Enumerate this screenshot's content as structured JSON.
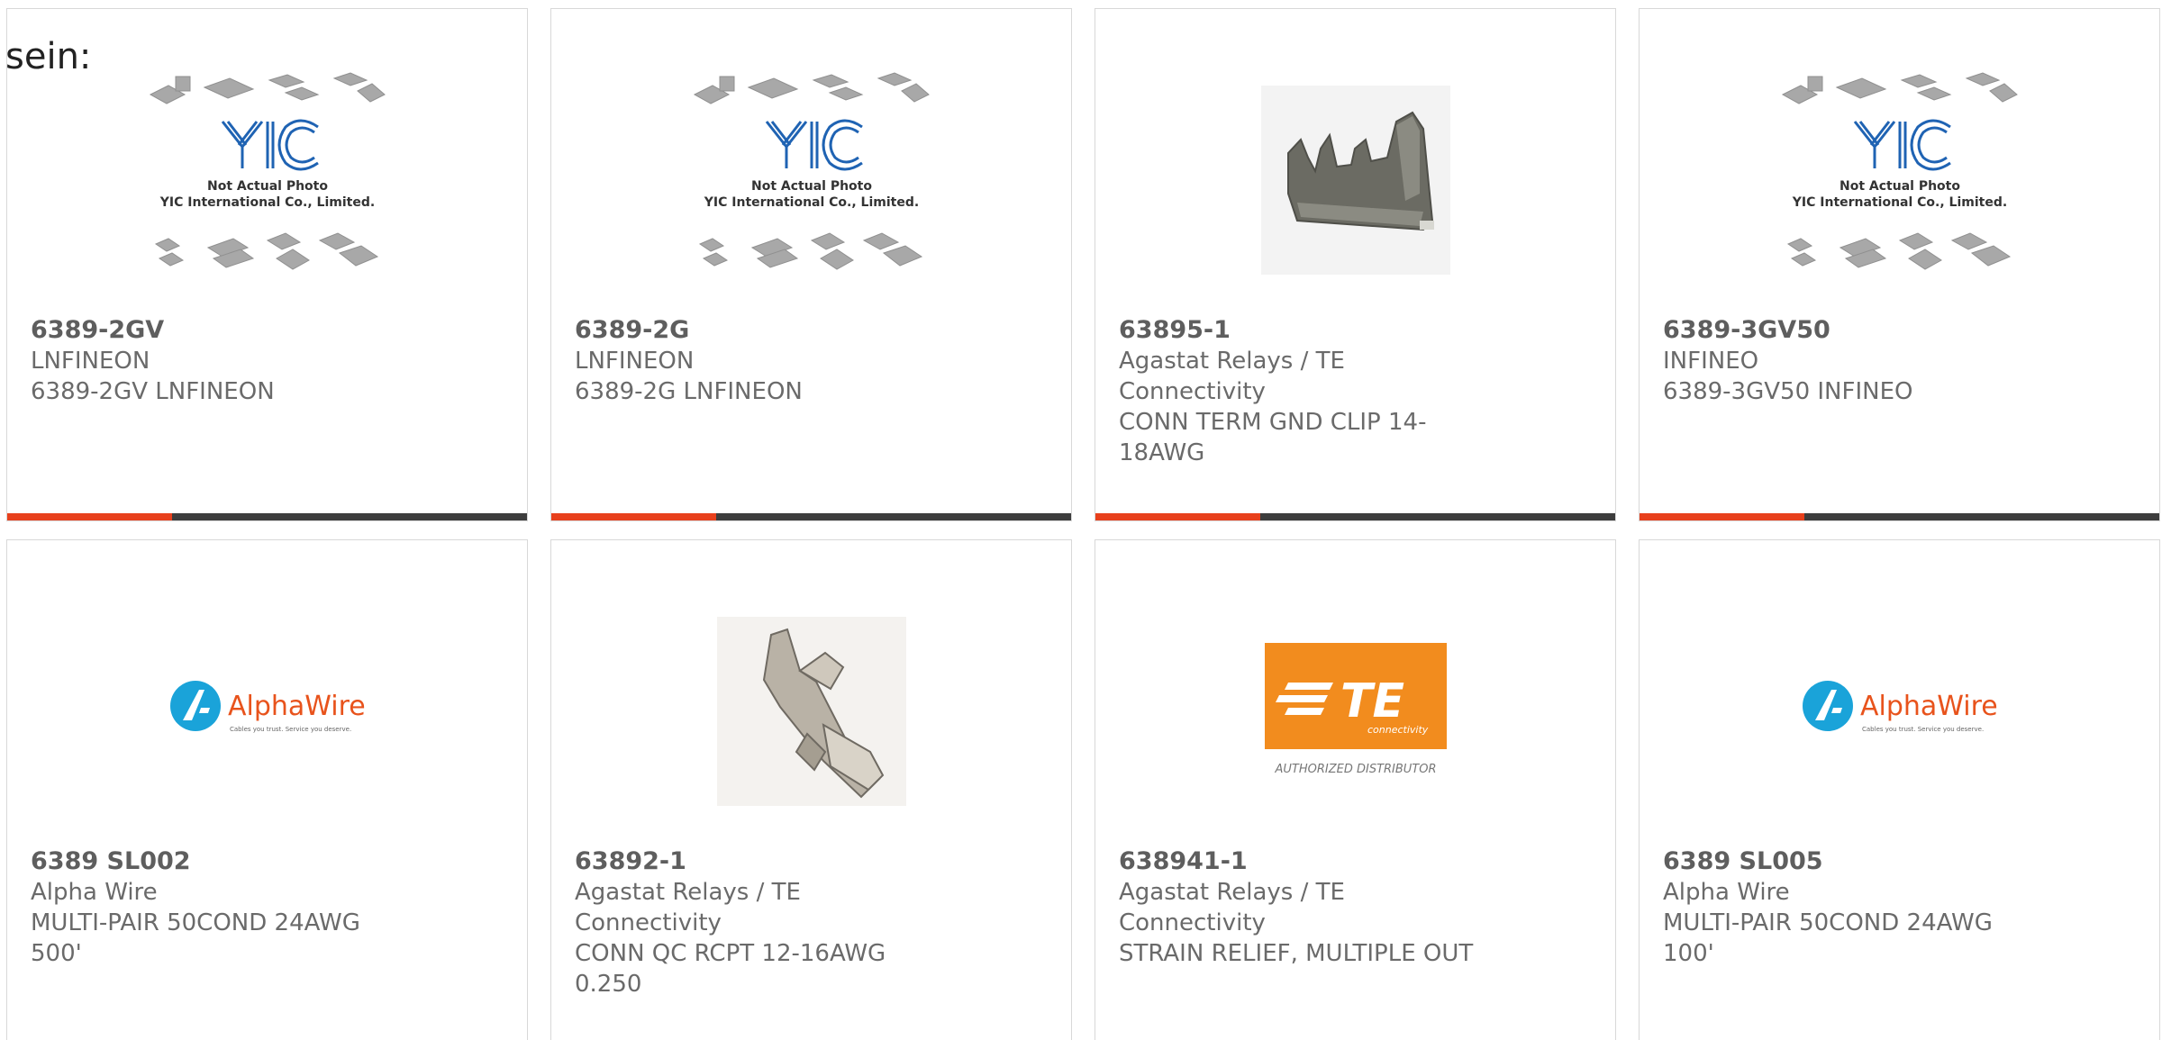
{
  "intro_text": "sein:",
  "placeholder_image": {
    "line1": "Not Actual Photo",
    "line2": "YIC International Co., Limited.",
    "logo": "YIC"
  },
  "alphawire_logo": {
    "name": "AlphaWire",
    "tagline": "Cables you trust. Service you deserve."
  },
  "te_logo": {
    "name": "TE",
    "sub": "connectivity",
    "caption": "AUTHORIZED DISTRIBUTOR",
    "color": "#f28c1e"
  },
  "colors": {
    "accent": "#e8401c",
    "bar": "#3d3d3d",
    "alphawire_blue": "#1aa3d9"
  },
  "products": [
    {
      "part": "6389-2GV",
      "maker": "LNFINEON",
      "desc": "6389-2GV LNFINEON",
      "image": "yic-placeholder"
    },
    {
      "part": "6389-2G",
      "maker": "LNFINEON",
      "desc": "6389-2G LNFINEON",
      "image": "yic-placeholder"
    },
    {
      "part": "63895-1",
      "maker": "Agastat Relays / TE Connectivity",
      "desc1": "CONN TERM GND CLIP 14-",
      "desc2": "18AWG",
      "image": "ground-clip-photo"
    },
    {
      "part": "6389-3GV50",
      "maker": "INFINEO",
      "desc": "6389-3GV50 INFINEO",
      "image": "yic-placeholder"
    },
    {
      "part": "6389 SL002",
      "maker": "Alpha Wire",
      "desc1": "MULTI-PAIR 50COND 24AWG",
      "desc2": "500'",
      "image": "alphawire-logo"
    },
    {
      "part": "63892-1",
      "maker": "Agastat Relays / TE Connectivity",
      "desc": "CONN QC RCPT 12-16AWG 0.250",
      "image": "receptacle-photo"
    },
    {
      "part": "638941-1",
      "maker": "Agastat Relays / TE Connectivity",
      "desc": "STRAIN RELIEF, MULTIPLE OUT",
      "image": "te-logo"
    },
    {
      "part": "6389 SL005",
      "maker": "Alpha Wire",
      "desc1": "MULTI-PAIR 50COND 24AWG",
      "desc2": "100'",
      "image": "alphawire-logo"
    }
  ]
}
